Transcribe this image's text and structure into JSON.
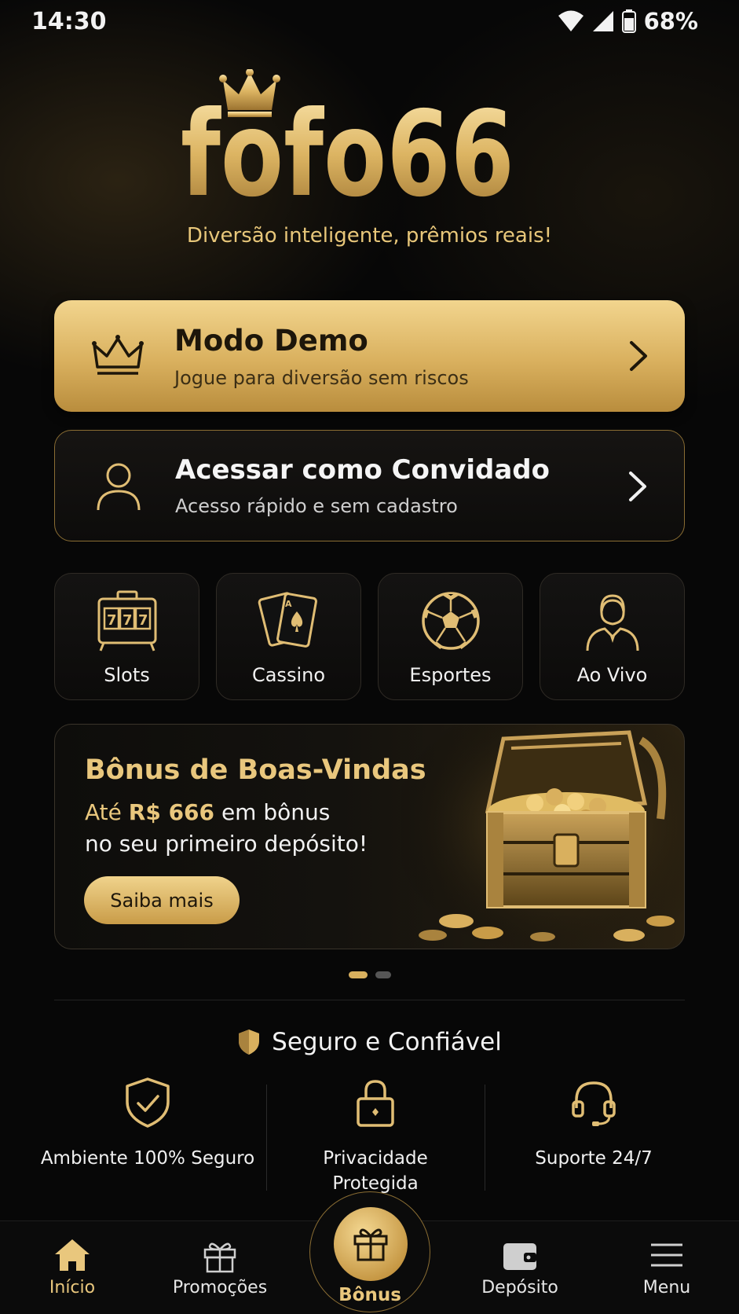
{
  "status_bar": {
    "time": "14:30",
    "battery": "68%"
  },
  "brand": {
    "name": "fofo66",
    "tagline": "Diversão inteligente, prêmios reais!"
  },
  "demo_card": {
    "title": "Modo Demo",
    "subtitle": "Jogue para diversão sem riscos",
    "icon": "crown-icon"
  },
  "guest_card": {
    "title": "Acessar como Convidado",
    "subtitle": "Acesso rápido e sem cadastro",
    "icon": "user-icon"
  },
  "categories": [
    {
      "label": "Slots",
      "icon": "slot-machine-icon"
    },
    {
      "label": "Cassino",
      "icon": "cards-icon"
    },
    {
      "label": "Esportes",
      "icon": "soccer-ball-icon"
    },
    {
      "label": "Ao Vivo",
      "icon": "dealer-icon"
    }
  ],
  "promo": {
    "title": "Bônus de Boas-Vindas",
    "line1_prefix": "Até",
    "amount": "R$ 666",
    "line1_suffix": "em bônus",
    "line2": "no seu primeiro depósito!",
    "button": "Saiba mais",
    "slides": 2,
    "active_slide": 1
  },
  "trust": {
    "title": "Seguro e Confiável",
    "items": [
      {
        "label": "Ambiente 100% Seguro",
        "icon": "shield-check-icon"
      },
      {
        "label_line1": "Privacidade",
        "label_line2": "Protegida",
        "icon": "lock-icon"
      },
      {
        "label": "Suporte 24/7",
        "icon": "headset-icon"
      }
    ]
  },
  "nav": {
    "home": "Início",
    "promos": "Promoções",
    "bonus": "Bônus",
    "deposit": "Depósito",
    "menu": "Menu",
    "active": "home"
  },
  "colors": {
    "gold": "#e9c77d",
    "gold_dark": "#c99c48",
    "background": "#070707"
  }
}
